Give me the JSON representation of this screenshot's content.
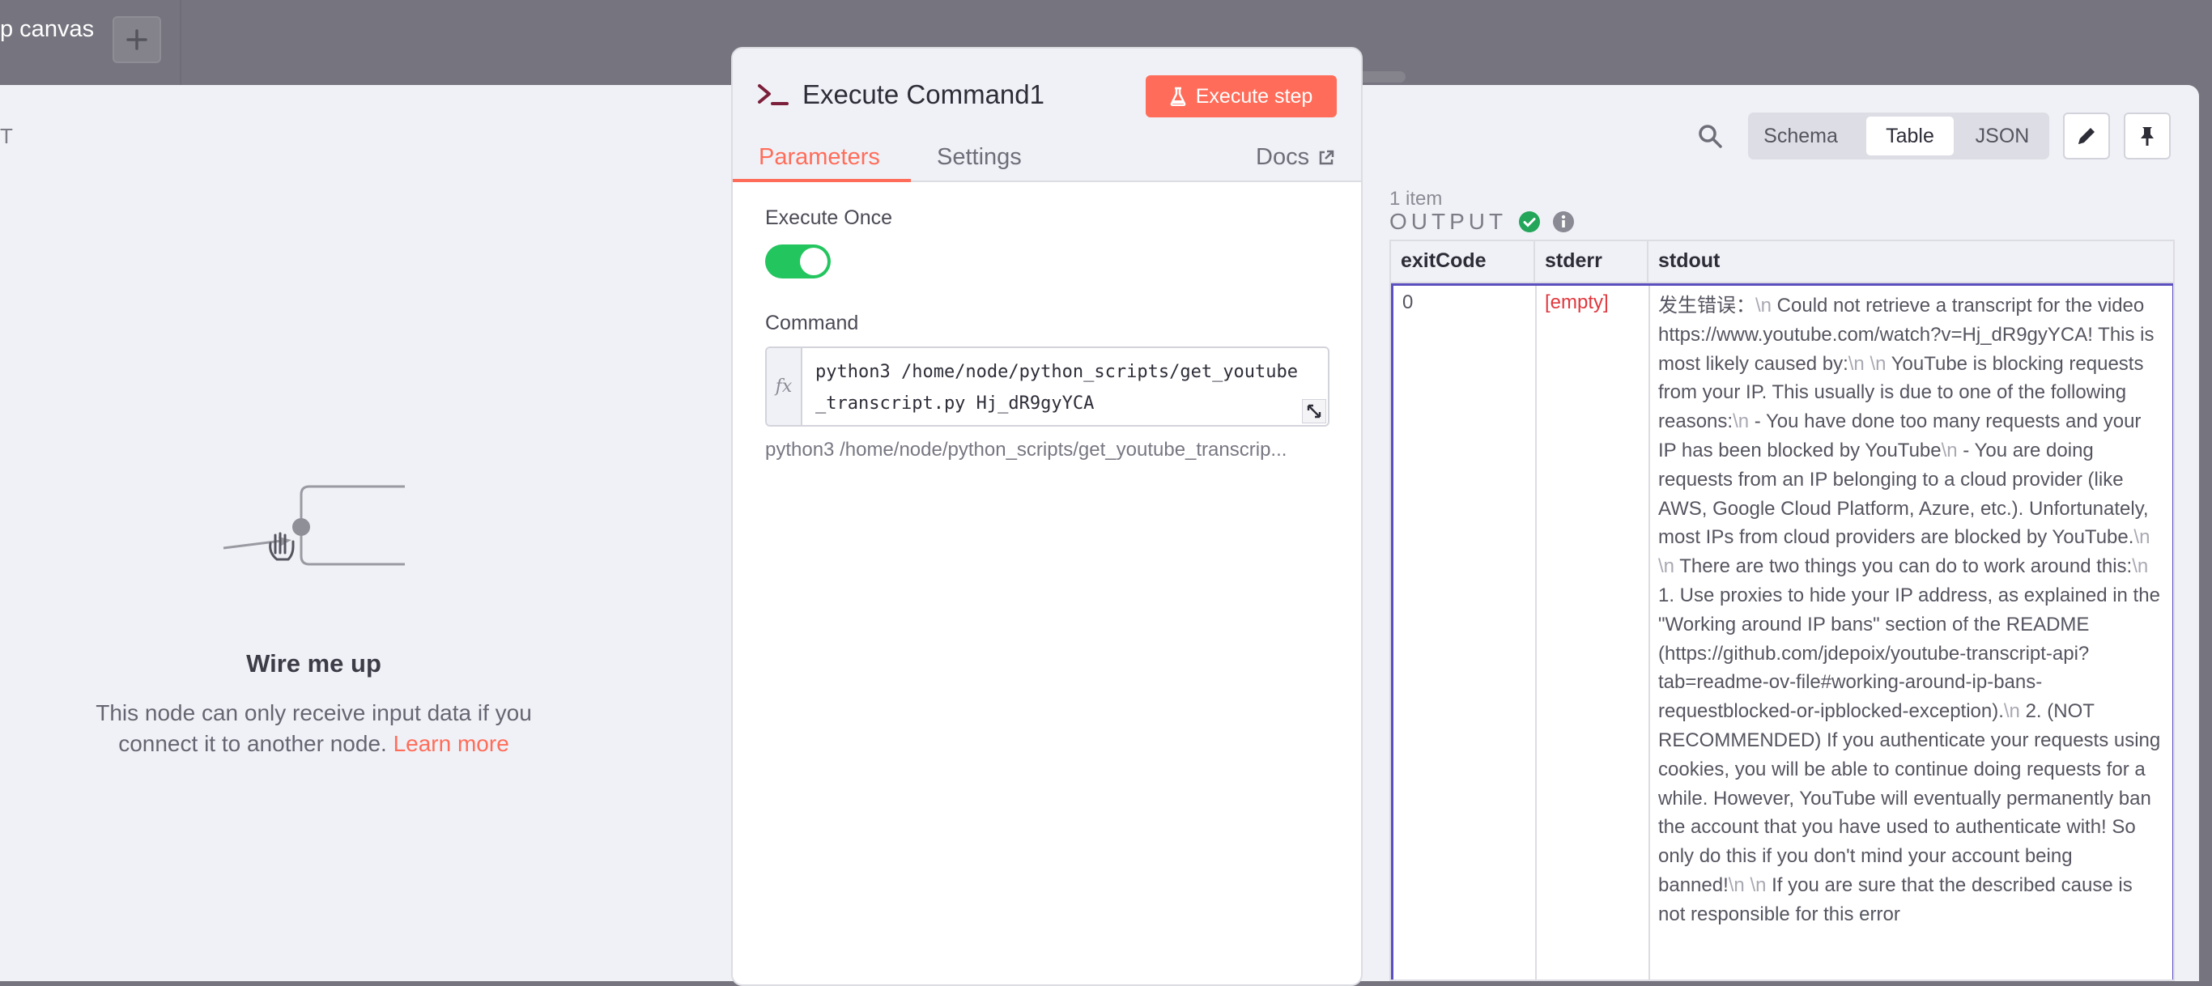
{
  "canvas": {
    "label": "p canvas",
    "add_label": "+"
  },
  "input_panel": {
    "title": "T",
    "empty_title": "Wire me up",
    "empty_desc": "This node can only receive input data if you connect it to another node.",
    "learn_more": "Learn more"
  },
  "node_panel": {
    "title": "Execute Command1",
    "execute_label": "Execute step",
    "tabs": [
      "Parameters",
      "Settings",
      "Docs"
    ],
    "execute_once_label": "Execute Once",
    "execute_once_value": true,
    "command_label": "Command",
    "command_value": "python3 /home/node/python_scripts/get_youtube_transcript.py Hj_dR9gyYCA",
    "command_hint": "python3 /home/node/python_scripts/get_youtube_transcrip...",
    "fx_label": "fx"
  },
  "output": {
    "title": "OUTPUT",
    "views": [
      "Schema",
      "Table",
      "JSON"
    ],
    "active_view": "Table",
    "item_count": "1 item",
    "columns": [
      "exitCode",
      "stderr",
      "stdout"
    ],
    "row": {
      "exitCode": "0",
      "stderr": "[empty]",
      "stdout_segments": [
        {
          "t": "发生错误："
        },
        {
          "t": "\\n",
          "esc": true
        },
        {
          "t": " Could not retrieve a transcript for the video https://www.youtube.com/watch?v=Hj_dR9gyYCA! This is most likely caused by:"
        },
        {
          "t": "\\n \\n",
          "esc": true
        },
        {
          "t": " YouTube is blocking requests from your IP. This usually is due to one of the following reasons:"
        },
        {
          "t": "\\n",
          "esc": true
        },
        {
          "t": " - You have done too many requests and your IP has been blocked by YouTube"
        },
        {
          "t": "\\n",
          "esc": true
        },
        {
          "t": " - You are doing requests from an IP belonging to a cloud provider (like AWS, Google Cloud Platform, Azure, etc.). Unfortunately, most IPs from cloud providers are blocked by YouTube."
        },
        {
          "t": "\\n \\n",
          "esc": true
        },
        {
          "t": " There are two things you can do to work around this:"
        },
        {
          "t": "\\n",
          "esc": true
        },
        {
          "t": " 1. Use proxies to hide your IP address, as explained in the \"Working around IP bans\" section of the README (https://github.com/jdepoix/youtube-transcript-api?tab=readme-ov-file#working-around-ip-bans-requestblocked-or-ipblocked-exception)."
        },
        {
          "t": "\\n",
          "esc": true
        },
        {
          "t": " 2. (NOT RECOMMENDED) If you authenticate your requests using cookies, you will be able to continue doing requests for a while. However, YouTube will eventually permanently ban the account that you have used to authenticate with! So only do this if you don't mind your account being banned!"
        },
        {
          "t": "\\n \\n",
          "esc": true
        },
        {
          "t": " If you are sure that the described cause is not responsible for this error"
        }
      ]
    }
  }
}
